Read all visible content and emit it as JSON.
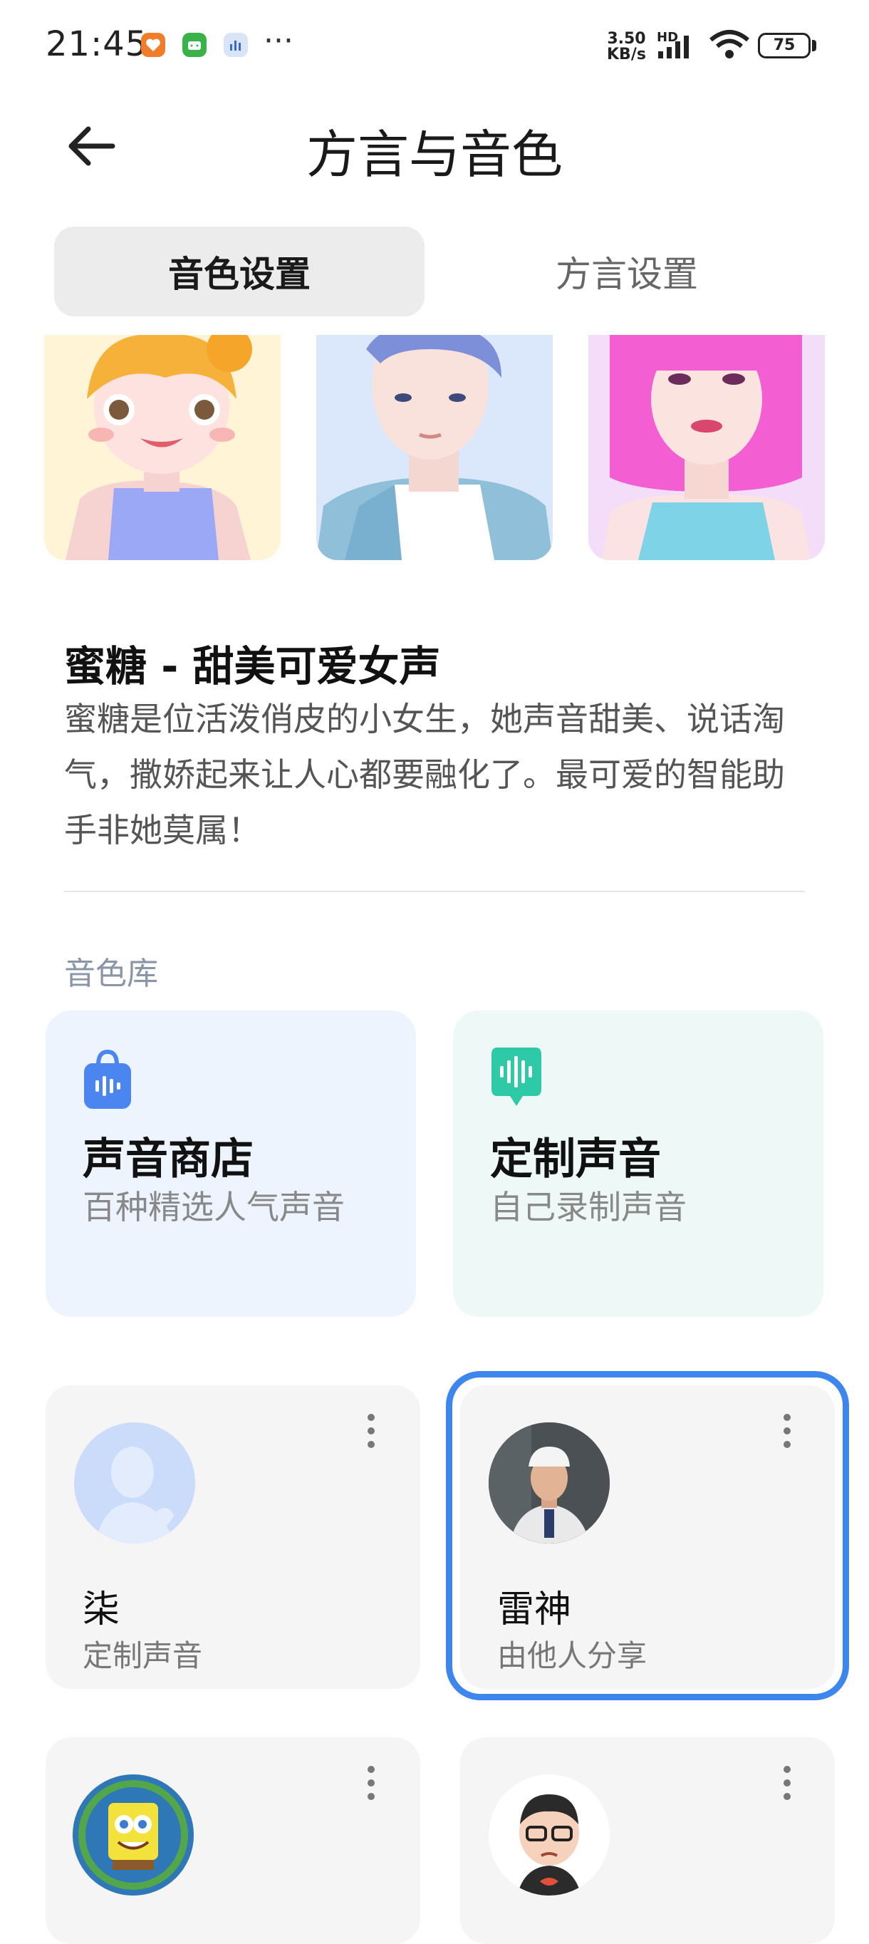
{
  "status_bar": {
    "time": "21:45",
    "speed_value": "3.50",
    "speed_unit": "KB/s",
    "network": "HD",
    "battery": "75",
    "more": "···"
  },
  "header": {
    "title": "方言与音色",
    "back_icon": "arrow-left-icon"
  },
  "tabs": [
    {
      "label": "音色设置",
      "active": true
    },
    {
      "label": "方言设置",
      "active": false
    }
  ],
  "current_voice": {
    "title": "蜜糖 - 甜美可爱女声",
    "description": "蜜糖是位活泼俏皮的小女生，她声音甜美、说话淘气，撒娇起来让人心都要融化了。最可爱的智能助手非她莫属！"
  },
  "library": {
    "section_label": "音色库",
    "cards": [
      {
        "title": "声音商店",
        "subtitle": "百种精选人气声音",
        "icon": "shopping-bag-sound-icon",
        "bg": "#eef4fd",
        "icon_color": "#4b86f0"
      },
      {
        "title": "定制声音",
        "subtitle": "自己录制声音",
        "icon": "speech-bubble-sound-icon",
        "bg": "#eef8f6",
        "icon_color": "#2ec9a6"
      }
    ]
  },
  "voices": [
    {
      "name": "柒",
      "subtitle": "定制声音",
      "selected": false
    },
    {
      "name": "雷神",
      "subtitle": "由他人分享",
      "selected": true
    },
    {
      "name": "",
      "subtitle": "",
      "selected": false
    },
    {
      "name": "",
      "subtitle": "",
      "selected": false
    }
  ],
  "colors": {
    "accent": "#3d86ee"
  }
}
